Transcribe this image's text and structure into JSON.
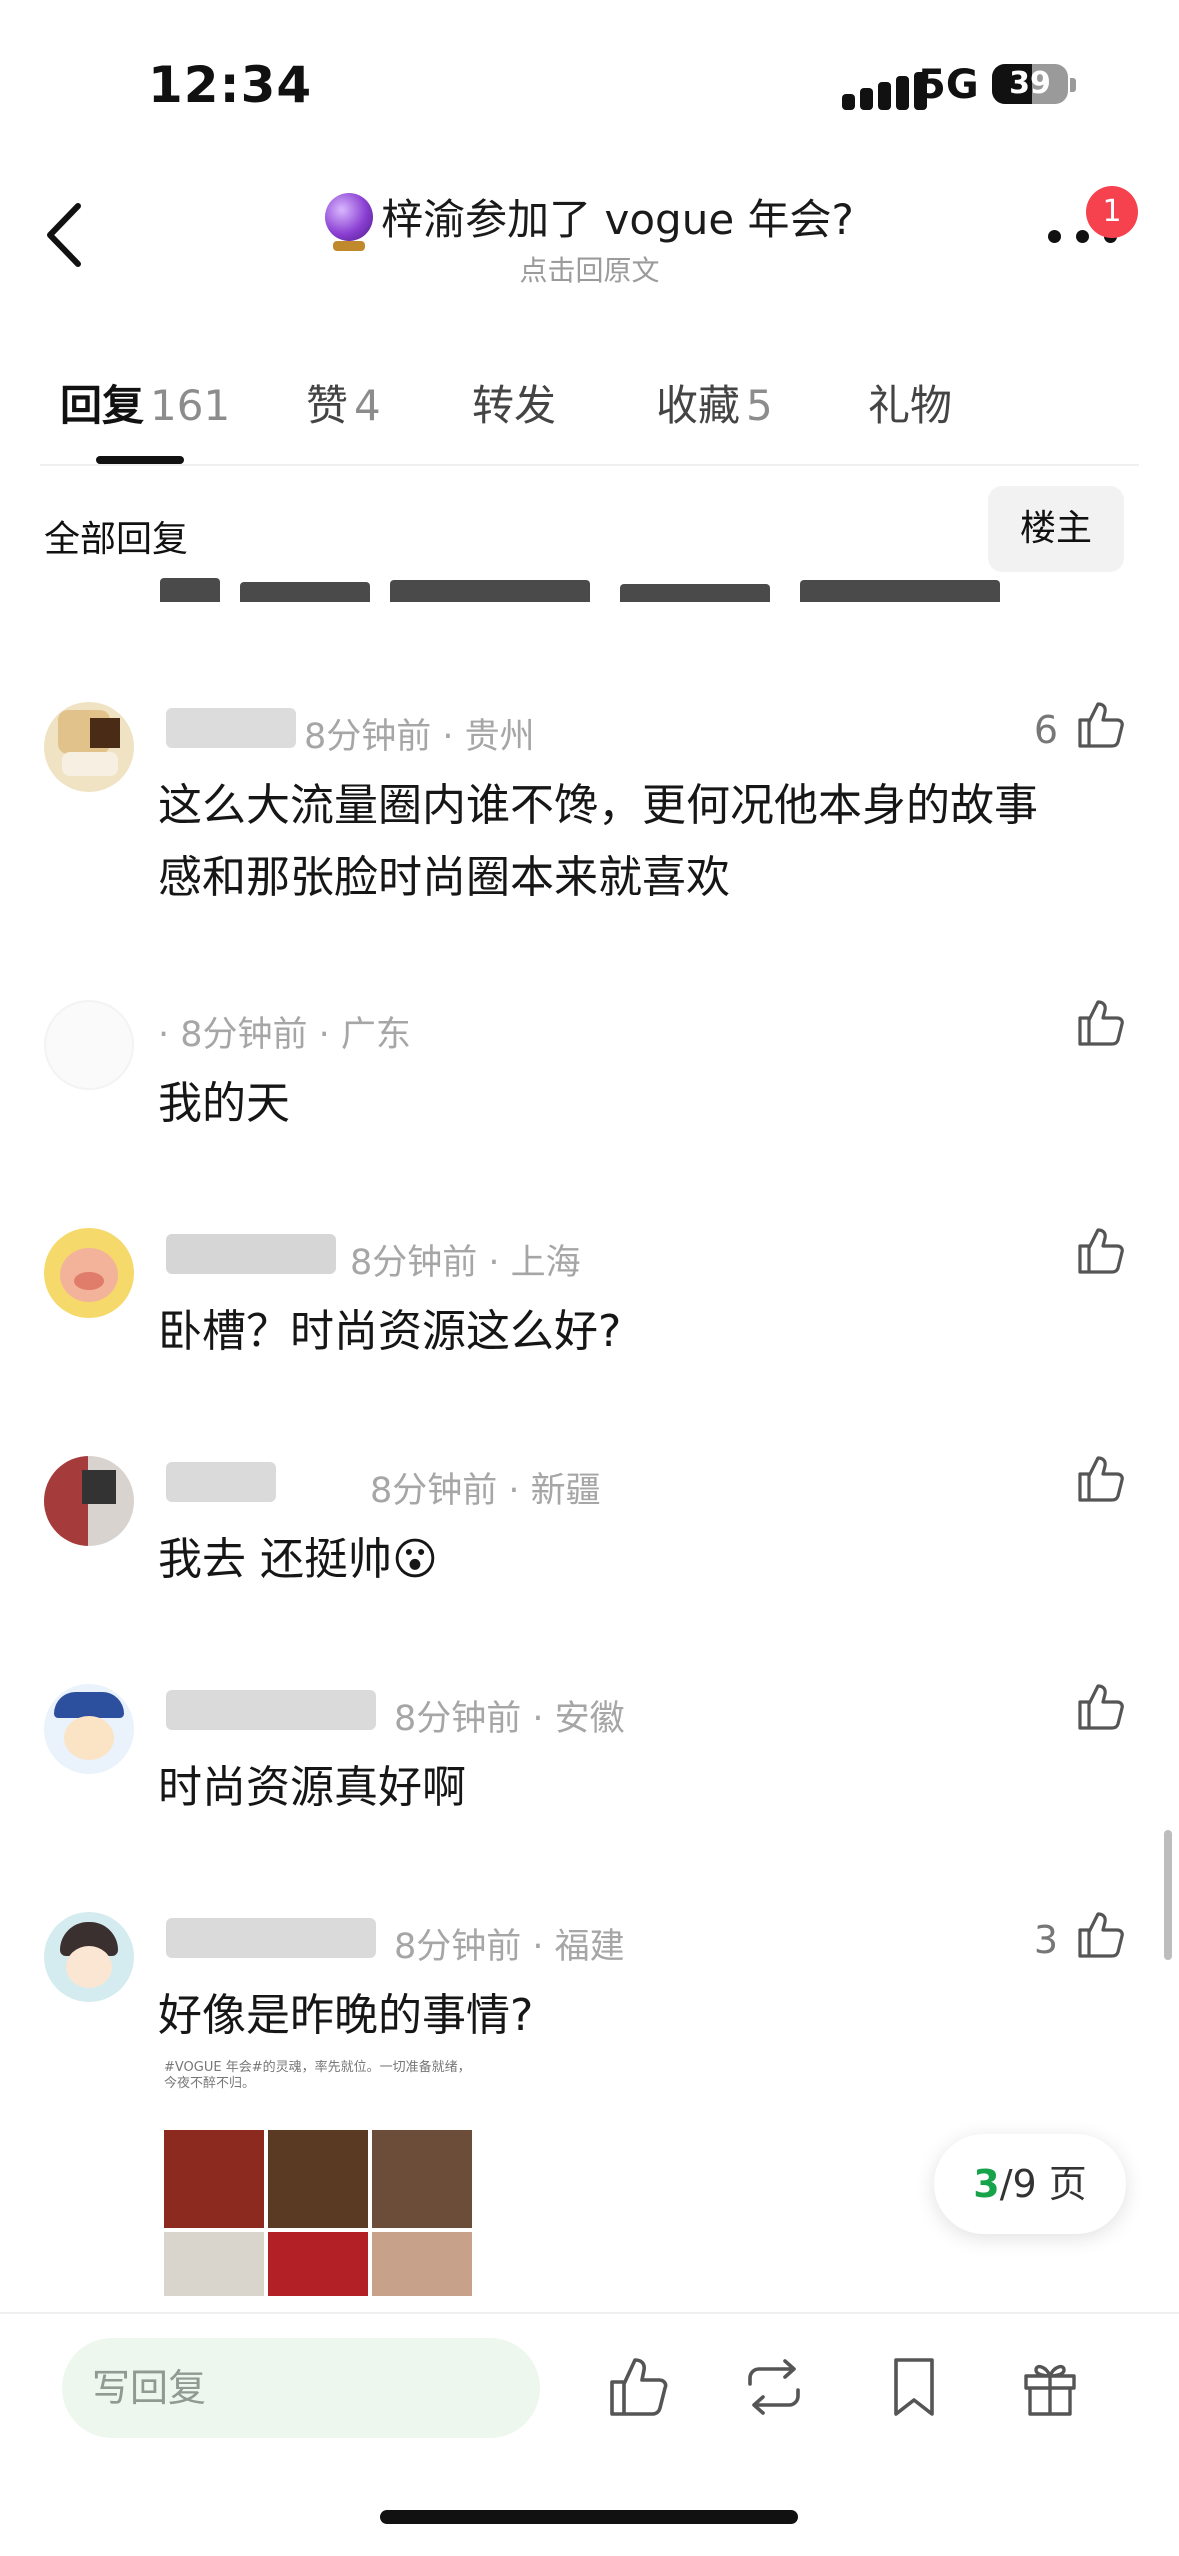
{
  "status_bar": {
    "time": "12:34",
    "network": "5G",
    "battery": "39"
  },
  "header": {
    "title": "梓渝参加了 vogue 年会?",
    "subtitle": "点击回原文",
    "notification_count": "1"
  },
  "tabs": [
    {
      "label": "回复",
      "count": "161"
    },
    {
      "label": "赞",
      "count": "4"
    },
    {
      "label": "转发",
      "count": ""
    },
    {
      "label": "收藏",
      "count": "5"
    },
    {
      "label": "礼物",
      "count": ""
    }
  ],
  "filter": {
    "title": "全部回复",
    "owner_button": "楼主"
  },
  "comments": [
    {
      "meta": "8分钟前 · 贵州",
      "likes": "6",
      "text_lines": [
        "这么大流量圈内谁不馋，更何况他本身的故事",
        "感和那张脸时尚圈本来就喜欢"
      ]
    },
    {
      "meta": "· 8分钟前 · 广东",
      "likes": "",
      "text_lines": [
        "我的天"
      ]
    },
    {
      "meta": "8分钟前 · 上海",
      "likes": "",
      "text_lines": [
        "卧槽？时尚资源这么好?"
      ]
    },
    {
      "meta": "8分钟前 · 新疆",
      "likes": "",
      "text_lines": [
        "我去 还挺帅😮"
      ]
    },
    {
      "meta": "8分钟前 · 安徽",
      "likes": "",
      "text_lines": [
        "时尚资源真好啊"
      ]
    },
    {
      "meta": "8分钟前 · 福建",
      "likes": "3",
      "text_lines": [
        "好像是昨晚的事情?"
      ]
    }
  ],
  "attachment": {
    "caption": "#VOGUE 年会#的灵魂，率先就位。一切准备就绪，今夜不醉不归。"
  },
  "pager": {
    "current": "3",
    "total": "/9 页"
  },
  "bottom_bar": {
    "reply_placeholder": "写回复"
  },
  "colors": {
    "accent_green": "#17a34a",
    "badge_red": "#f5424e",
    "input_bg": "#edf7ee"
  }
}
